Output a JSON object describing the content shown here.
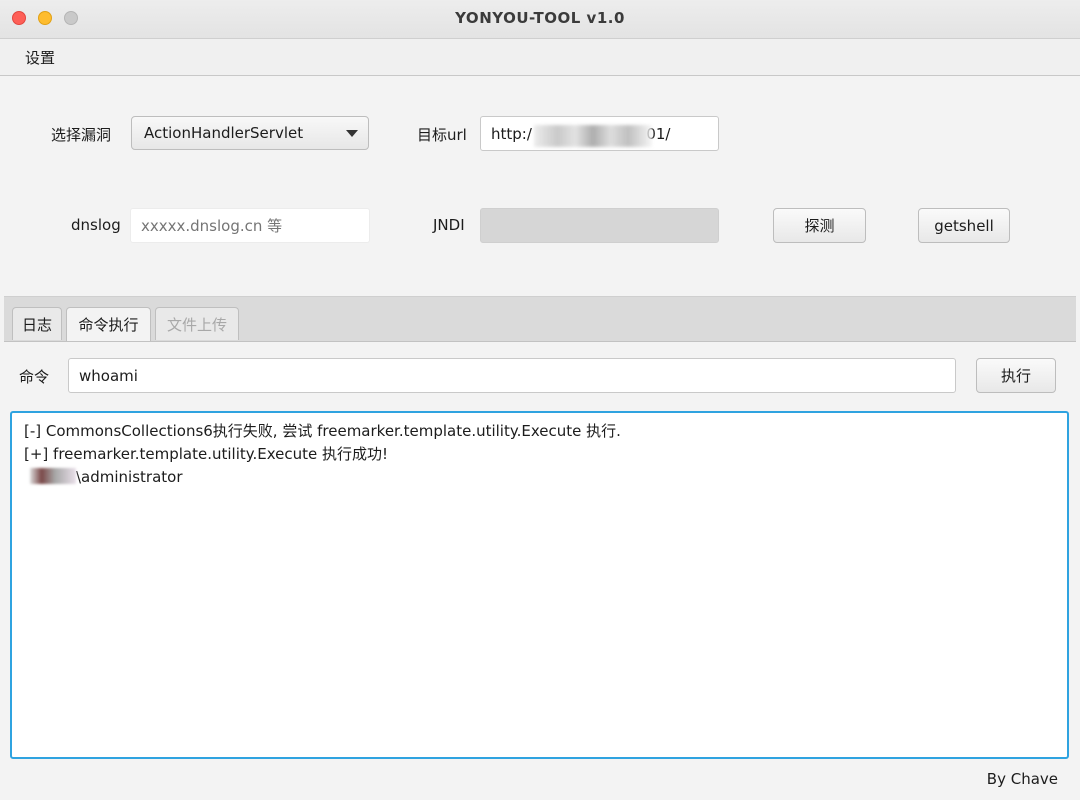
{
  "window": {
    "title": "YONYOU-TOOL v1.0"
  },
  "menu": {
    "settings": "设置"
  },
  "form": {
    "vuln_label": "选择漏洞",
    "vuln_selected": "ActionHandlerServlet",
    "url_label": "目标url",
    "url_value": "http:/                        01/",
    "dnslog_label": "dnslog",
    "dnslog_placeholder": "xxxxx.dnslog.cn 等",
    "jndi_label": "JNDI",
    "detect_button": "探测",
    "getshell_button": "getshell"
  },
  "tabs": [
    {
      "label": "日志",
      "state": "normal"
    },
    {
      "label": "命令执行",
      "state": "active"
    },
    {
      "label": "文件上传",
      "state": "disabled"
    }
  ],
  "command": {
    "label": "命令",
    "value": "whoami",
    "execute_button": "执行"
  },
  "output": {
    "lines": [
      "[-] CommonsCollections6执行失败, 尝试 freemarker.template.utility.Execute 执行.",
      "[+] freemarker.template.utility.Execute 执行成功!",
      "\\administrator"
    ]
  },
  "footer": {
    "credit": "By Chave"
  },
  "colors": {
    "focus_border": "#2fa3e0",
    "close": "#fe5f57",
    "minimize": "#febc2e",
    "maximize": "#c9c9c9"
  }
}
